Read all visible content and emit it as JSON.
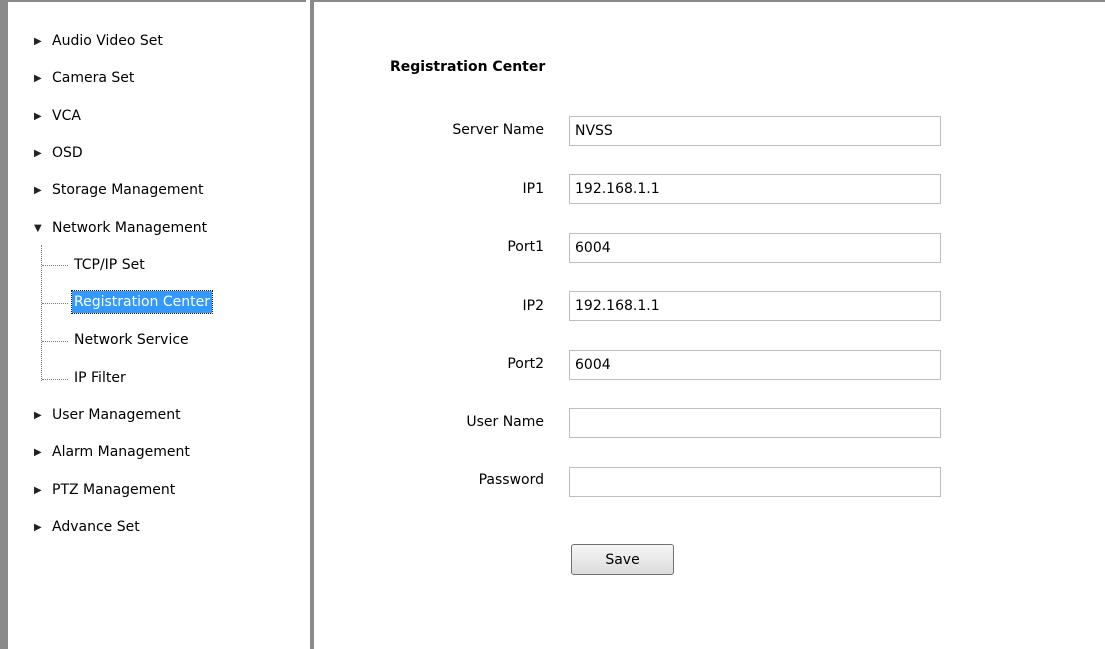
{
  "sidebar": {
    "items": [
      {
        "label": "Audio Video Set",
        "expanded": false
      },
      {
        "label": "Camera Set",
        "expanded": false
      },
      {
        "label": "VCA",
        "expanded": false
      },
      {
        "label": "OSD",
        "expanded": false
      },
      {
        "label": "Storage Management",
        "expanded": false
      },
      {
        "label": "Network Management",
        "expanded": true
      },
      {
        "label": "User Management",
        "expanded": false
      },
      {
        "label": "Alarm Management",
        "expanded": false
      },
      {
        "label": "PTZ Management",
        "expanded": false
      },
      {
        "label": "Advance Set",
        "expanded": false
      }
    ],
    "network_children": [
      {
        "label": "TCP/IP Set"
      },
      {
        "label": "Registration Center",
        "selected": true
      },
      {
        "label": "Network Service"
      },
      {
        "label": "IP Filter"
      }
    ],
    "selected_color": "#3399ff"
  },
  "main": {
    "title": "Registration Center",
    "fields": {
      "server_name": {
        "label": "Server Name",
        "value": "NVSS"
      },
      "ip1": {
        "label": "IP1",
        "value": "192.168.1.1"
      },
      "port1": {
        "label": "Port1",
        "value": "6004"
      },
      "ip2": {
        "label": "IP2",
        "value": "192.168.1.1"
      },
      "port2": {
        "label": "Port2",
        "value": "6004"
      },
      "user_name": {
        "label": "User Name",
        "value": ""
      },
      "password": {
        "label": "Password",
        "value": ""
      }
    },
    "save_label": "Save"
  }
}
